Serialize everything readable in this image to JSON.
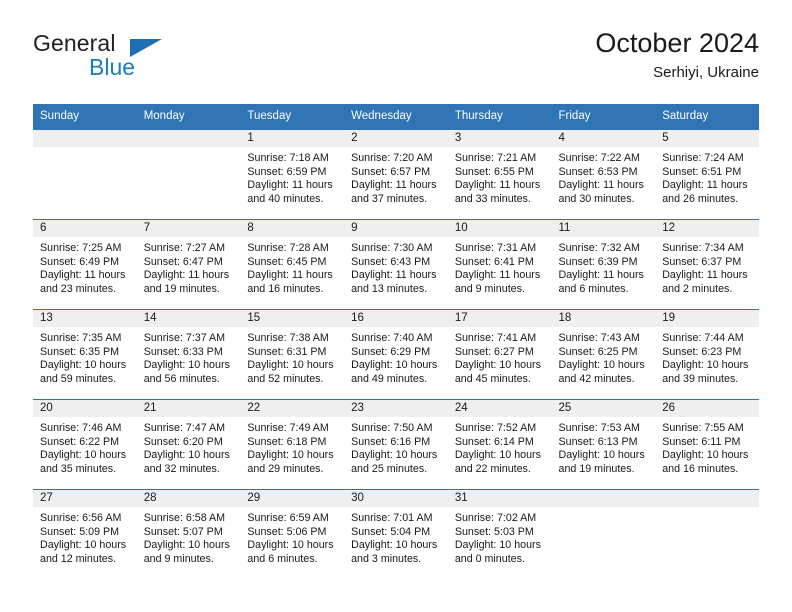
{
  "brand": {
    "name_part1": "General",
    "name_part2": "Blue",
    "triangle_color": "#1f6fb5",
    "blue_color": "#1b7bc4"
  },
  "header": {
    "title": "October 2024",
    "subtitle": "Serhiyi, Ukraine"
  },
  "colors": {
    "header_blue": "#2f74b5",
    "daynum_band": "#efefef",
    "row_rule": "#2f74b5"
  },
  "weekday_headers": [
    "Sunday",
    "Monday",
    "Tuesday",
    "Wednesday",
    "Thursday",
    "Friday",
    "Saturday"
  ],
  "labels": {
    "sunrise": "Sunrise:",
    "sunset": "Sunset:",
    "daylight": "Daylight:"
  },
  "weeks": [
    [
      {
        "day": "",
        "sunrise": "",
        "sunset": "",
        "daylight": ""
      },
      {
        "day": "",
        "sunrise": "",
        "sunset": "",
        "daylight": ""
      },
      {
        "day": "1",
        "sunrise": "Sunrise: 7:18 AM",
        "sunset": "Sunset: 6:59 PM",
        "daylight": "Daylight: 11 hours and 40 minutes."
      },
      {
        "day": "2",
        "sunrise": "Sunrise: 7:20 AM",
        "sunset": "Sunset: 6:57 PM",
        "daylight": "Daylight: 11 hours and 37 minutes."
      },
      {
        "day": "3",
        "sunrise": "Sunrise: 7:21 AM",
        "sunset": "Sunset: 6:55 PM",
        "daylight": "Daylight: 11 hours and 33 minutes."
      },
      {
        "day": "4",
        "sunrise": "Sunrise: 7:22 AM",
        "sunset": "Sunset: 6:53 PM",
        "daylight": "Daylight: 11 hours and 30 minutes."
      },
      {
        "day": "5",
        "sunrise": "Sunrise: 7:24 AM",
        "sunset": "Sunset: 6:51 PM",
        "daylight": "Daylight: 11 hours and 26 minutes."
      }
    ],
    [
      {
        "day": "6",
        "sunrise": "Sunrise: 7:25 AM",
        "sunset": "Sunset: 6:49 PM",
        "daylight": "Daylight: 11 hours and 23 minutes."
      },
      {
        "day": "7",
        "sunrise": "Sunrise: 7:27 AM",
        "sunset": "Sunset: 6:47 PM",
        "daylight": "Daylight: 11 hours and 19 minutes."
      },
      {
        "day": "8",
        "sunrise": "Sunrise: 7:28 AM",
        "sunset": "Sunset: 6:45 PM",
        "daylight": "Daylight: 11 hours and 16 minutes."
      },
      {
        "day": "9",
        "sunrise": "Sunrise: 7:30 AM",
        "sunset": "Sunset: 6:43 PM",
        "daylight": "Daylight: 11 hours and 13 minutes."
      },
      {
        "day": "10",
        "sunrise": "Sunrise: 7:31 AM",
        "sunset": "Sunset: 6:41 PM",
        "daylight": "Daylight: 11 hours and 9 minutes."
      },
      {
        "day": "11",
        "sunrise": "Sunrise: 7:32 AM",
        "sunset": "Sunset: 6:39 PM",
        "daylight": "Daylight: 11 hours and 6 minutes."
      },
      {
        "day": "12",
        "sunrise": "Sunrise: 7:34 AM",
        "sunset": "Sunset: 6:37 PM",
        "daylight": "Daylight: 11 hours and 2 minutes."
      }
    ],
    [
      {
        "day": "13",
        "sunrise": "Sunrise: 7:35 AM",
        "sunset": "Sunset: 6:35 PM",
        "daylight": "Daylight: 10 hours and 59 minutes."
      },
      {
        "day": "14",
        "sunrise": "Sunrise: 7:37 AM",
        "sunset": "Sunset: 6:33 PM",
        "daylight": "Daylight: 10 hours and 56 minutes."
      },
      {
        "day": "15",
        "sunrise": "Sunrise: 7:38 AM",
        "sunset": "Sunset: 6:31 PM",
        "daylight": "Daylight: 10 hours and 52 minutes."
      },
      {
        "day": "16",
        "sunrise": "Sunrise: 7:40 AM",
        "sunset": "Sunset: 6:29 PM",
        "daylight": "Daylight: 10 hours and 49 minutes."
      },
      {
        "day": "17",
        "sunrise": "Sunrise: 7:41 AM",
        "sunset": "Sunset: 6:27 PM",
        "daylight": "Daylight: 10 hours and 45 minutes."
      },
      {
        "day": "18",
        "sunrise": "Sunrise: 7:43 AM",
        "sunset": "Sunset: 6:25 PM",
        "daylight": "Daylight: 10 hours and 42 minutes."
      },
      {
        "day": "19",
        "sunrise": "Sunrise: 7:44 AM",
        "sunset": "Sunset: 6:23 PM",
        "daylight": "Daylight: 10 hours and 39 minutes."
      }
    ],
    [
      {
        "day": "20",
        "sunrise": "Sunrise: 7:46 AM",
        "sunset": "Sunset: 6:22 PM",
        "daylight": "Daylight: 10 hours and 35 minutes."
      },
      {
        "day": "21",
        "sunrise": "Sunrise: 7:47 AM",
        "sunset": "Sunset: 6:20 PM",
        "daylight": "Daylight: 10 hours and 32 minutes."
      },
      {
        "day": "22",
        "sunrise": "Sunrise: 7:49 AM",
        "sunset": "Sunset: 6:18 PM",
        "daylight": "Daylight: 10 hours and 29 minutes."
      },
      {
        "day": "23",
        "sunrise": "Sunrise: 7:50 AM",
        "sunset": "Sunset: 6:16 PM",
        "daylight": "Daylight: 10 hours and 25 minutes."
      },
      {
        "day": "24",
        "sunrise": "Sunrise: 7:52 AM",
        "sunset": "Sunset: 6:14 PM",
        "daylight": "Daylight: 10 hours and 22 minutes."
      },
      {
        "day": "25",
        "sunrise": "Sunrise: 7:53 AM",
        "sunset": "Sunset: 6:13 PM",
        "daylight": "Daylight: 10 hours and 19 minutes."
      },
      {
        "day": "26",
        "sunrise": "Sunrise: 7:55 AM",
        "sunset": "Sunset: 6:11 PM",
        "daylight": "Daylight: 10 hours and 16 minutes."
      }
    ],
    [
      {
        "day": "27",
        "sunrise": "Sunrise: 6:56 AM",
        "sunset": "Sunset: 5:09 PM",
        "daylight": "Daylight: 10 hours and 12 minutes."
      },
      {
        "day": "28",
        "sunrise": "Sunrise: 6:58 AM",
        "sunset": "Sunset: 5:07 PM",
        "daylight": "Daylight: 10 hours and 9 minutes."
      },
      {
        "day": "29",
        "sunrise": "Sunrise: 6:59 AM",
        "sunset": "Sunset: 5:06 PM",
        "daylight": "Daylight: 10 hours and 6 minutes."
      },
      {
        "day": "30",
        "sunrise": "Sunrise: 7:01 AM",
        "sunset": "Sunset: 5:04 PM",
        "daylight": "Daylight: 10 hours and 3 minutes."
      },
      {
        "day": "31",
        "sunrise": "Sunrise: 7:02 AM",
        "sunset": "Sunset: 5:03 PM",
        "daylight": "Daylight: 10 hours and 0 minutes."
      },
      {
        "day": "",
        "sunrise": "",
        "sunset": "",
        "daylight": ""
      },
      {
        "day": "",
        "sunrise": "",
        "sunset": "",
        "daylight": ""
      }
    ]
  ]
}
